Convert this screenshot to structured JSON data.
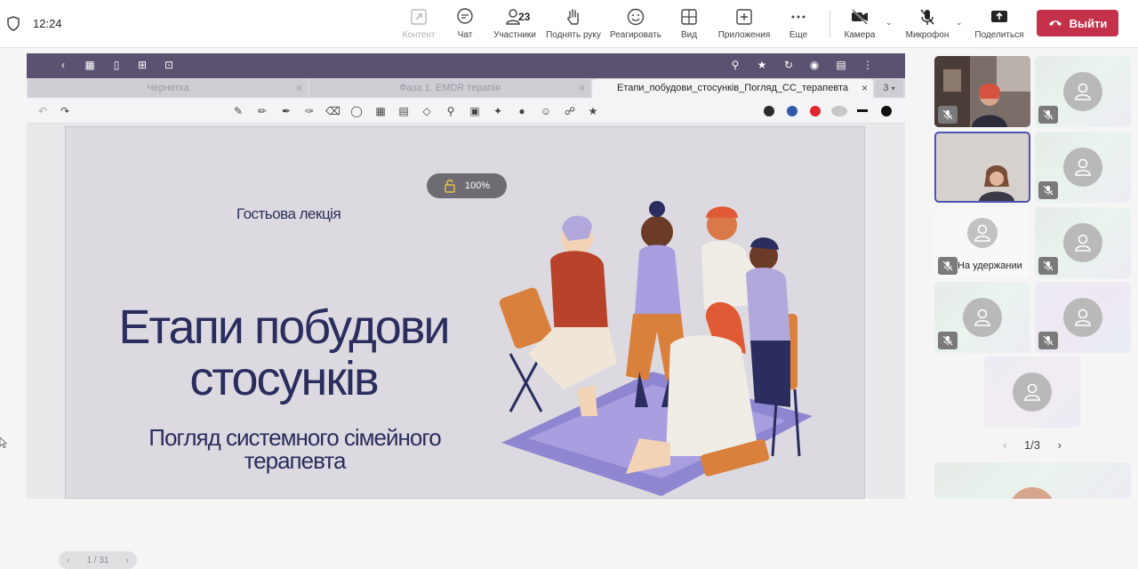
{
  "status": {
    "time": "12:24"
  },
  "toolbar": {
    "content_label": "Контент",
    "chat_label": "Чат",
    "participants_label": "Участники",
    "participants_count": "23",
    "raise_hand_label": "Поднять руку",
    "react_label": "Реагировать",
    "view_label": "Вид",
    "apps_label": "Приложения",
    "more_label": "Еще",
    "camera_label": "Камера",
    "mic_label": "Микрофон",
    "share_label": "Поделиться",
    "leave_label": "Выйти"
  },
  "doc_tabs": [
    {
      "label": "Чернетка"
    },
    {
      "label": "Фаза 1. EMDR терапія"
    },
    {
      "label": "Етапи_побудови_стосунків_Погляд_СС_терапевта"
    },
    {
      "label": "3"
    }
  ],
  "slide": {
    "zoom": "100%",
    "guest_label": "Гостьова лекція",
    "title_line1": "Етапи побудови",
    "title_line2": "стосунків",
    "subtitle_line1": "Погляд системного сімейного",
    "subtitle_line2": "терапевта",
    "page": "1 / 31"
  },
  "participants": {
    "hold_label": "На удержании",
    "page": "1/3"
  },
  "colors": {
    "leave": "#c4314b",
    "app_toolbar": "#5a5270",
    "slide_title": "#2a2d5e",
    "pen_black": "#2b2b2b",
    "pen_blue": "#2f5aa8",
    "pen_red": "#e0262c"
  }
}
